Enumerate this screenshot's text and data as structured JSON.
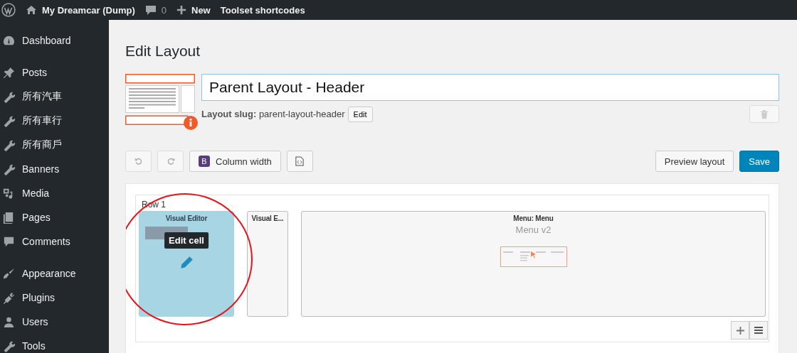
{
  "top_bar": {
    "site_name": "My Dreamcar (Dump)",
    "comments_count": "0",
    "new_label": "New",
    "shortcodes_label": "Toolset shortcodes"
  },
  "sidebar": {
    "groups": [
      {
        "items": [
          {
            "label": "Dashboard"
          }
        ]
      },
      {
        "items": [
          {
            "label": "Posts"
          },
          {
            "label": "所有汽車"
          },
          {
            "label": "所有車行"
          },
          {
            "label": "所有商戶"
          },
          {
            "label": "Banners"
          },
          {
            "label": "Media"
          },
          {
            "label": "Pages"
          },
          {
            "label": "Comments"
          }
        ]
      },
      {
        "items": [
          {
            "label": "Appearance"
          },
          {
            "label": "Plugins"
          },
          {
            "label": "Users"
          },
          {
            "label": "Tools"
          }
        ]
      }
    ]
  },
  "page": {
    "title": "Edit Layout",
    "layout_name": "Parent Layout - Header",
    "slug_label": "Layout slug:",
    "slug": "parent-layout-header",
    "slug_edit": "Edit"
  },
  "toolbar": {
    "undo": {
      "disabled": true
    },
    "redo": {
      "disabled": true
    },
    "column_width": {
      "badge": "B",
      "label": "Column width"
    },
    "preview": "Preview layout",
    "save": "Save"
  },
  "rows": [
    {
      "label": "Row 1",
      "cells": [
        {
          "kind": "visual_editor",
          "title": "Visual Editor",
          "highlighted": true,
          "tooltip": "Edit cell"
        },
        {
          "kind": "visual_editor",
          "title": "Visual E...",
          "highlighted": false
        },
        {
          "kind": "menu",
          "title": "Menu: Menu",
          "subtitle": "Menu v2",
          "highlighted": false
        }
      ]
    }
  ],
  "annotation": {
    "circled": true
  }
}
